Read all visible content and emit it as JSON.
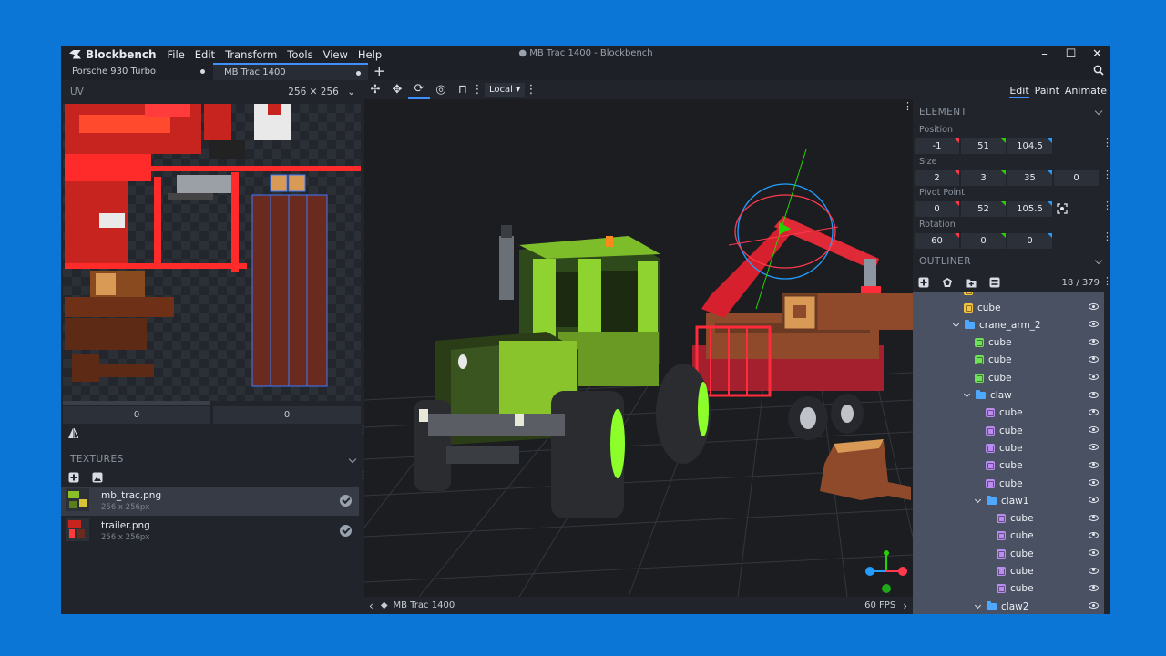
{
  "app": {
    "name": "Blockbench",
    "window_title": "● MB Trac 1400 - Blockbench"
  },
  "menu": [
    "File",
    "Edit",
    "Transform",
    "Tools",
    "View",
    "Help"
  ],
  "window_controls": {
    "minimize": "–",
    "maximize": "☐",
    "close": "✕"
  },
  "tabs": [
    {
      "label": "Porsche 930 Turbo",
      "active": false
    },
    {
      "label": "MB Trac 1400",
      "active": true
    }
  ],
  "tab_add": "+",
  "uv": {
    "title": "UV",
    "size": "256 ✕ 256",
    "fields": [
      "0",
      "0"
    ]
  },
  "textures": {
    "title": "TEXTURES",
    "items": [
      {
        "name": "mb_trac.png",
        "dims": "256 x 256px",
        "selected": true
      },
      {
        "name": "trailer.png",
        "dims": "256 x 256px",
        "selected": false
      }
    ]
  },
  "viewport": {
    "space": "Local ▾",
    "model_name": "MB Trac 1400",
    "fps": "60 FPS"
  },
  "modes": {
    "edit": "Edit",
    "paint": "Paint",
    "animate": "Animate",
    "active": "Edit"
  },
  "element": {
    "title": "ELEMENT",
    "position": {
      "label": "Position",
      "values": [
        "-1",
        "51",
        "104.5"
      ]
    },
    "size": {
      "label": "Size",
      "values": [
        "2",
        "3",
        "35",
        "0"
      ]
    },
    "pivot": {
      "label": "Pivot Point",
      "values": [
        "0",
        "52",
        "105.5"
      ]
    },
    "rotation": {
      "label": "Rotation",
      "values": [
        "60",
        "0",
        "0"
      ]
    }
  },
  "outliner": {
    "title": "OUTLINER",
    "count": "18 / 379",
    "rows": [
      {
        "type": "cube",
        "label": "cube",
        "color": "#f4c542"
      },
      {
        "type": "group",
        "label": "crane_arm_2"
      },
      {
        "type": "cube",
        "label": "cube",
        "color": "#6fe05a"
      },
      {
        "type": "cube",
        "label": "cube",
        "color": "#6fe05a"
      },
      {
        "type": "cube",
        "label": "cube",
        "color": "#6fe05a"
      },
      {
        "type": "group",
        "label": "claw"
      },
      {
        "type": "cube",
        "label": "cube",
        "color": "#b98cf0"
      },
      {
        "type": "cube",
        "label": "cube",
        "color": "#b98cf0"
      },
      {
        "type": "cube",
        "label": "cube",
        "color": "#b98cf0"
      },
      {
        "type": "cube",
        "label": "cube",
        "color": "#b98cf0"
      },
      {
        "type": "cube",
        "label": "cube",
        "color": "#b98cf0"
      },
      {
        "type": "group",
        "label": "claw1"
      },
      {
        "type": "cube",
        "label": "cube",
        "color": "#b98cf0"
      },
      {
        "type": "cube",
        "label": "cube",
        "color": "#b98cf0"
      },
      {
        "type": "cube",
        "label": "cube",
        "color": "#b98cf0"
      },
      {
        "type": "cube",
        "label": "cube",
        "color": "#b98cf0"
      },
      {
        "type": "cube",
        "label": "cube",
        "color": "#b98cf0"
      },
      {
        "type": "group",
        "label": "claw2"
      }
    ]
  },
  "colors": {
    "accent": "#3e90ff",
    "desktop": "#0b76d6",
    "x_axis": "#ff3a4f",
    "y_axis": "#23d400",
    "z_axis": "#239dff"
  }
}
